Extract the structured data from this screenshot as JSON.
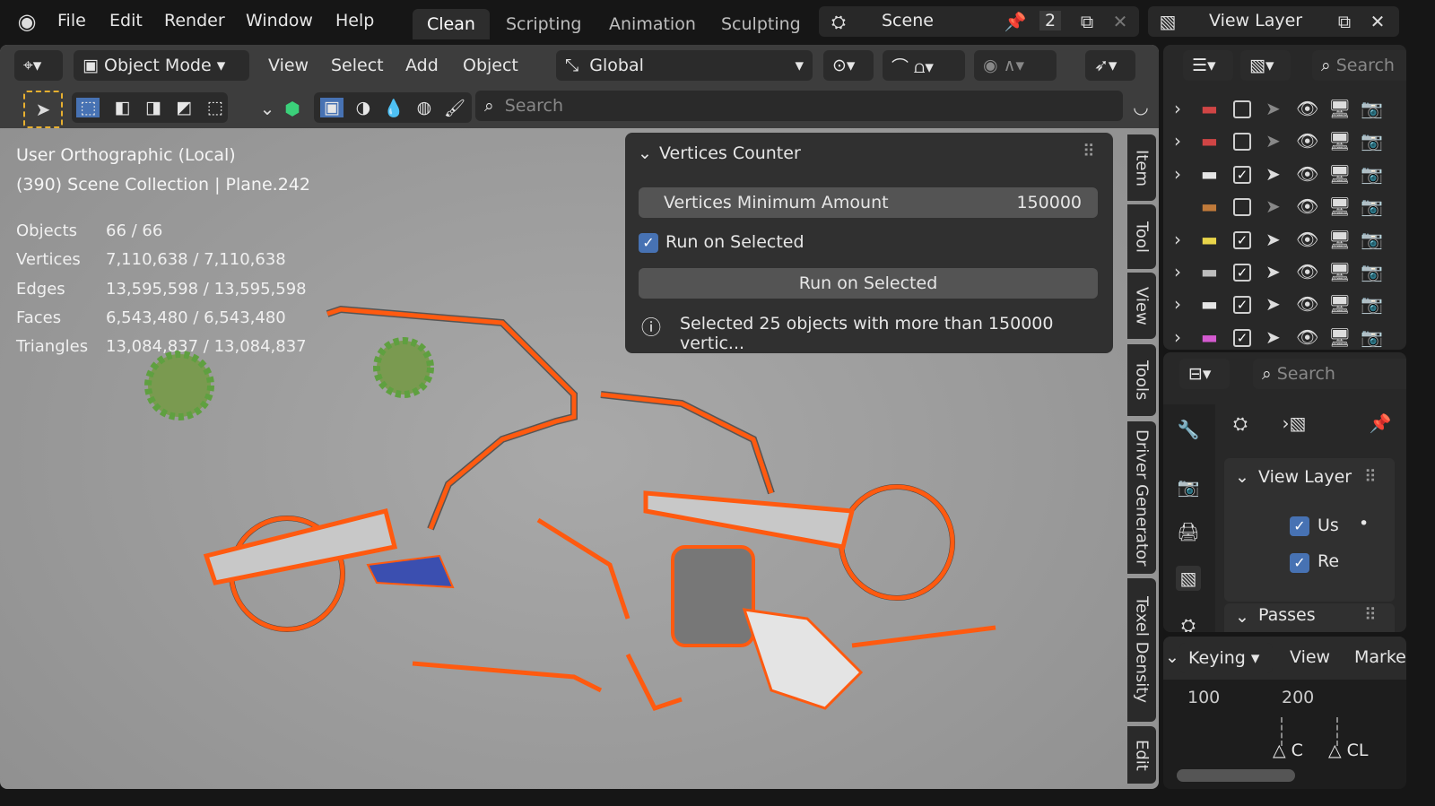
{
  "menu": {
    "file": "File",
    "edit": "Edit",
    "render": "Render",
    "window": "Window",
    "help": "Help"
  },
  "workspaces": [
    "Clean",
    "Scripting",
    "Animation",
    "Sculpting"
  ],
  "scene": {
    "name": "Scene",
    "users": "2"
  },
  "view_layer": {
    "name": "View Layer"
  },
  "viewport_header": {
    "mode": "Object Mode",
    "view": "View",
    "select": "Select",
    "add": "Add",
    "object": "Object",
    "orientation": "Global",
    "search_placeholder": "Search"
  },
  "overlay": {
    "view_name": "User Orthographic (Local)",
    "collection": "(390) Scene Collection | Plane.242"
  },
  "stats": [
    {
      "label": "Objects",
      "value": "66 / 66"
    },
    {
      "label": "Vertices",
      "value": "7,110,638 / 7,110,638"
    },
    {
      "label": "Edges",
      "value": "13,595,598 / 13,595,598"
    },
    {
      "label": "Faces",
      "value": "6,543,480 / 6,543,480"
    },
    {
      "label": "Triangles",
      "value": "13,084,837 / 13,084,837"
    }
  ],
  "vertices_panel": {
    "title": "Vertices Counter",
    "min_label": "Vertices Minimum Amount",
    "min_value": "150000",
    "run_checkbox": "Run on Selected",
    "run_checked": true,
    "run_button": "Run on Selected",
    "info": "Selected 25 objects with more than 150000 vertic..."
  },
  "n_tabs": [
    "Item",
    "Tool",
    "View",
    "Tools",
    "Driver Generator",
    "Texel Density",
    "Edit"
  ],
  "outliner": {
    "search_placeholder": "Search",
    "rows": [
      {
        "color": "#d04545",
        "expand": true,
        "checked": false
      },
      {
        "color": "#d04545",
        "expand": true,
        "checked": false
      },
      {
        "color": "#e6e6e6",
        "expand": true,
        "checked": true
      },
      {
        "color": "#c07a3a",
        "expand": false,
        "checked": false
      },
      {
        "color": "#e8d44a",
        "expand": true,
        "checked": true
      },
      {
        "color": "#bdbdbd",
        "expand": true,
        "checked": true
      },
      {
        "color": "#e6e6e6",
        "expand": true,
        "checked": true
      },
      {
        "color": "#d45ad0",
        "expand": true,
        "checked": true
      }
    ]
  },
  "properties": {
    "search_placeholder": "Search",
    "panel_title": "View Layer",
    "use_label": "Us",
    "render_label": "Re",
    "passes": "Passes"
  },
  "timeline": {
    "keying": "Keying",
    "view": "View",
    "marker": "Marke",
    "ticks": [
      "100",
      "200"
    ],
    "markers": [
      "C",
      "CL"
    ]
  }
}
